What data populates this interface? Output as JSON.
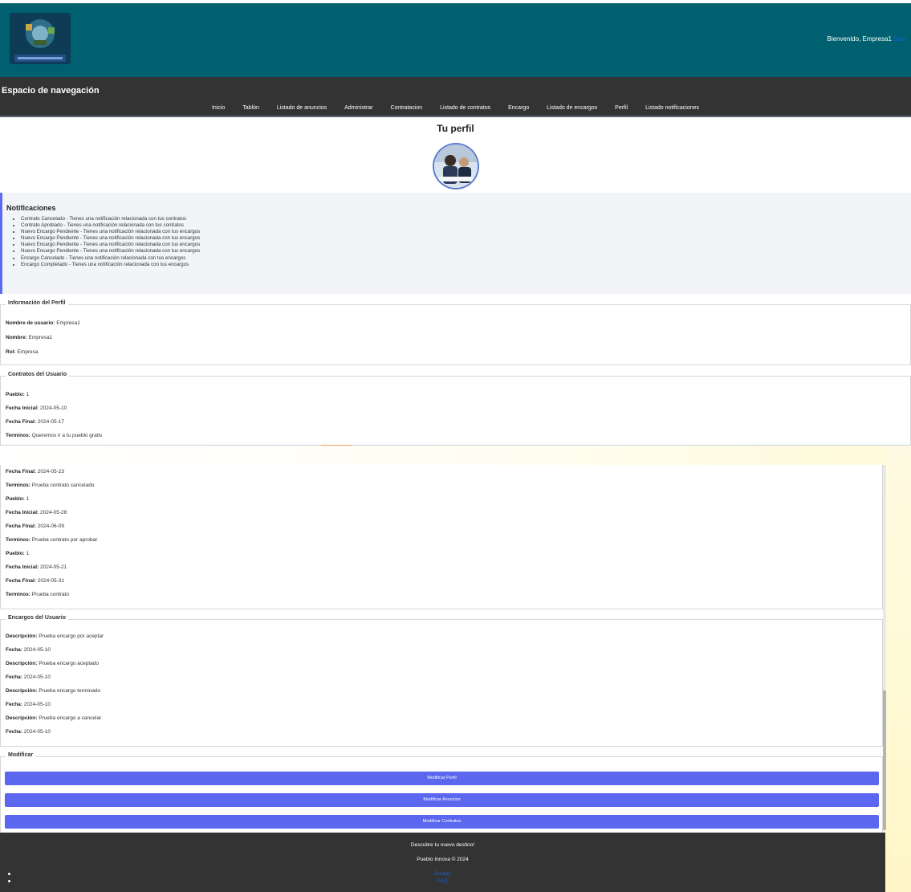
{
  "header": {
    "welcome": "Bienvenido, Empresa1",
    "logout": "Salir"
  },
  "nav": {
    "title": "Espacio de navegación",
    "links": [
      "Inicio",
      "Tablón",
      "Listado de anuncios",
      "Administrar",
      "Contratacion",
      "Listado de contratos",
      "Encargo",
      "Listado de encargos",
      "Perfil",
      "Listado notificaciones"
    ]
  },
  "profile": {
    "title": "Tu perfil"
  },
  "notifications": {
    "title": "Notificaciones",
    "items": [
      "Contrato Cancelado - Tienes una notificación relacionada con tus contratos",
      "Contrato Aprobado - Tienes una notificación relacionada con tus contratos",
      "Nuevo Encargo Pendiente - Tienes una notificación relacionada con tus encargos",
      "Nuevo Encargo Pendiente - Tienes una notificación relacionada con tus encargos",
      "Nuevo Encargo Pendiente - Tienes una notificación relacionada con tus encargos",
      "Nuevo Encargo Pendiente - Tienes una notificación relacionada con tus encargos",
      "Encargo Cancelado - Tienes una notificación relacionada con tus encargos",
      "Encargo Completado - Tienes una notificación relacionada con tus encargos"
    ]
  },
  "info": {
    "legend": "Información del Perfil",
    "username_label": "Nombre de usuario:",
    "username": "Empresa1",
    "name_label": "Nombre:",
    "name": "Empresa1",
    "role_label": "Rol:",
    "role": "Empresa"
  },
  "contracts": {
    "legend": "Contratos del Usuario",
    "top": [
      {
        "label": "Pueblo:",
        "value": "1"
      },
      {
        "label": "Fecha Inicial:",
        "value": "2024-05-10"
      },
      {
        "label": "Fecha Final:",
        "value": "2024-05-17"
      },
      {
        "label": "Terminos:",
        "value": "Queremos ir a tu pueblo gratis"
      }
    ],
    "bottom": [
      {
        "label": "Fecha Final:",
        "value": "2024-05-23"
      },
      {
        "label": "Terminos:",
        "value": "Prueba contrato cancelado"
      },
      {
        "label": "Pueblo:",
        "value": "1"
      },
      {
        "label": "Fecha Inicial:",
        "value": "2024-05-28"
      },
      {
        "label": "Fecha Final:",
        "value": "2024-06-09"
      },
      {
        "label": "Terminos:",
        "value": "Prueba contrato por aprobar"
      },
      {
        "label": "Pueblo:",
        "value": "1"
      },
      {
        "label": "Fecha Inicial:",
        "value": "2024-05-21"
      },
      {
        "label": "Fecha Final:",
        "value": "2024-05-31"
      },
      {
        "label": "Terminos:",
        "value": "Prueba contrato"
      }
    ]
  },
  "orders": {
    "legend": "Encargos del Usuario",
    "rows": [
      {
        "label": "Descripción:",
        "value": "Prueba encargo por aceptar"
      },
      {
        "label": "Fecha:",
        "value": "2024-05-10"
      },
      {
        "label": "Descripción:",
        "value": "Prueba encargo aceptado"
      },
      {
        "label": "Fecha:",
        "value": "2024-05-10"
      },
      {
        "label": "Descripción:",
        "value": "Prueba encargo terminado"
      },
      {
        "label": "Fecha:",
        "value": "2024-05-10"
      },
      {
        "label": "Descripción:",
        "value": "Prueba encargo a cancelar"
      },
      {
        "label": "Fecha:",
        "value": "2024-05-10"
      }
    ]
  },
  "modify": {
    "legend": "Modificar",
    "buttons": [
      "Modificar Perfil",
      "Modificar Anuncios",
      "Modificar Contratos"
    ]
  },
  "footer": {
    "slogan": "Descubre tu nuevo destino!",
    "copyright": "Pueblo Innova © 2024",
    "links": [
      "Google",
      "FAQ"
    ]
  },
  "colors": {
    "header_bg": "#00606f",
    "nav_bg": "#333333",
    "button_bg": "#5a67ee",
    "notif_accent": "#5a6cf0"
  }
}
